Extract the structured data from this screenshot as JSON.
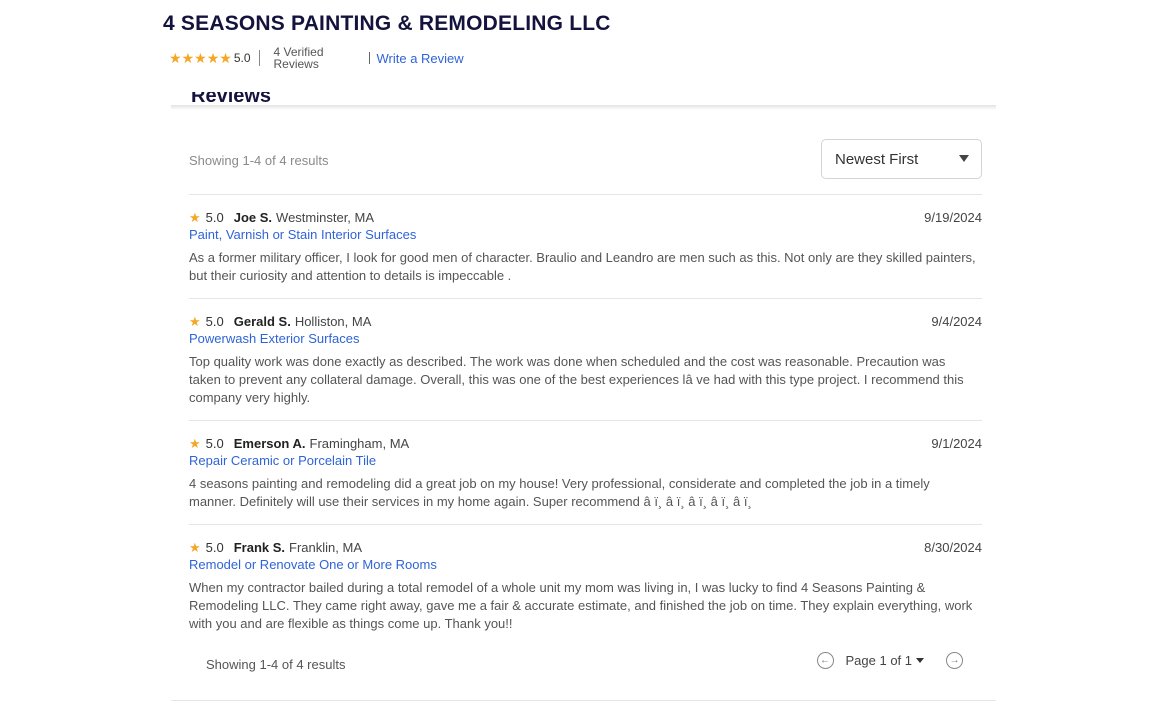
{
  "business": {
    "name": "4 SEASONS PAINTING & REMODELING LLC",
    "rating": "5.0",
    "verified_line1": "4 Verified",
    "verified_line2": "Reviews",
    "write_review": "Write a Review"
  },
  "reviews_section": {
    "heading": "Reviews",
    "showing_top": "Showing 1-4 of 4 results",
    "sort_selected": "Newest First",
    "showing_bottom": "Showing 1-4 of 4 results",
    "page_label": "Page 1 of 1"
  },
  "reviews": [
    {
      "rating": "5.0",
      "name": "Joe S.",
      "location": "Westminster, MA",
      "date": "9/19/2024",
      "service": "Paint, Varnish or Stain Interior Surfaces",
      "text": "As a former military officer, I look for good men of character. Braulio and Leandro are men such as this. Not only are they skilled painters, but their curiosity and attention to details is impeccable ."
    },
    {
      "rating": "5.0",
      "name": "Gerald S.",
      "location": "Holliston, MA",
      "date": "9/4/2024",
      "service": "Powerwash Exterior Surfaces",
      "text": "Top quality work was done exactly as described. The work was done when scheduled and the cost was reasonable. Precaution was taken to prevent any collateral damage. Overall, this was one of the best experiences lâ ve had with this type project. I recommend this company very highly."
    },
    {
      "rating": "5.0",
      "name": "Emerson A.",
      "location": "Framingham, MA",
      "date": "9/1/2024",
      "service": "Repair Ceramic or Porcelain Tile",
      "text": "4 seasons painting and remodeling did a great job on my house! Very professional, considerate and completed the job in a timely manner. Definitely will use their services in my home again. Super recommend â ï¸ â ï¸ â ï¸ â ï¸ â ï¸"
    },
    {
      "rating": "5.0",
      "name": "Frank S.",
      "location": "Franklin, MA",
      "date": "8/30/2024",
      "service": "Remodel or Renovate One or More Rooms",
      "text": "When my contractor bailed during a total remodel of a whole unit my mom was living in, I was lucky to find 4 Seasons Painting & Remodeling LLC. They came right away, gave me a fair & accurate estimate, and finished the job on time. They explain everything, work with you and are flexible as things come up. Thank you!!"
    }
  ],
  "colors": {
    "title": "#13133d",
    "link": "#2f64d8",
    "star": "#f5a623"
  },
  "icons": {
    "star": "★",
    "prev": "←",
    "next": "→"
  }
}
